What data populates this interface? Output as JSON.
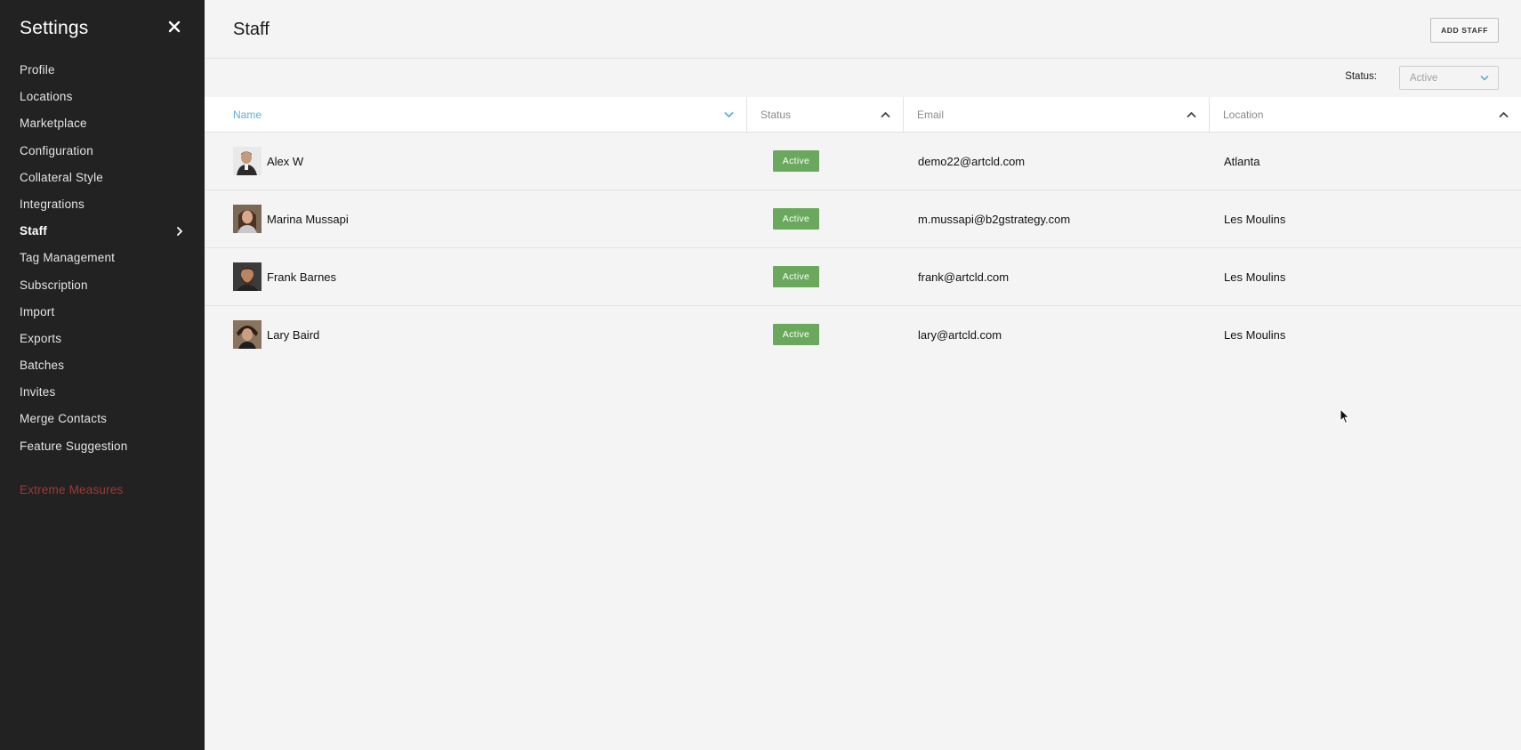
{
  "sidebar": {
    "title": "Settings",
    "close_icon": "close-icon",
    "items": [
      {
        "label": "Profile"
      },
      {
        "label": "Locations"
      },
      {
        "label": "Marketplace"
      },
      {
        "label": "Configuration"
      },
      {
        "label": "Collateral Style"
      },
      {
        "label": "Integrations"
      },
      {
        "label": "Staff",
        "active": true
      },
      {
        "label": "Tag Management"
      },
      {
        "label": "Subscription"
      },
      {
        "label": "Import"
      },
      {
        "label": "Exports"
      },
      {
        "label": "Batches"
      },
      {
        "label": "Invites"
      },
      {
        "label": "Merge Contacts"
      },
      {
        "label": "Feature Suggestion"
      }
    ],
    "danger_item": "Extreme Measures"
  },
  "header": {
    "title": "Staff",
    "add_button": "ADD STAFF"
  },
  "filter": {
    "label": "Status:",
    "value": "Active"
  },
  "table": {
    "columns": {
      "name": "Name",
      "status": "Status",
      "email": "Email",
      "location": "Location"
    },
    "rows": [
      {
        "name": "Alex W",
        "status": "Active",
        "email": "demo22@artcld.com",
        "location": "Atlanta"
      },
      {
        "name": "Marina Mussapi",
        "status": "Active",
        "email": "m.mussapi@b2gstrategy.com",
        "location": "Les Moulins"
      },
      {
        "name": "Frank Barnes",
        "status": "Active",
        "email": "frank@artcld.com",
        "location": "Les Moulins"
      },
      {
        "name": "Lary Baird",
        "status": "Active",
        "email": "lary@artcld.com",
        "location": "Les Moulins"
      }
    ]
  },
  "colors": {
    "sidebar_bg": "#222222",
    "accent": "#5bb0d6",
    "status_active": "#6aa95d",
    "danger": "#9c3b33"
  }
}
